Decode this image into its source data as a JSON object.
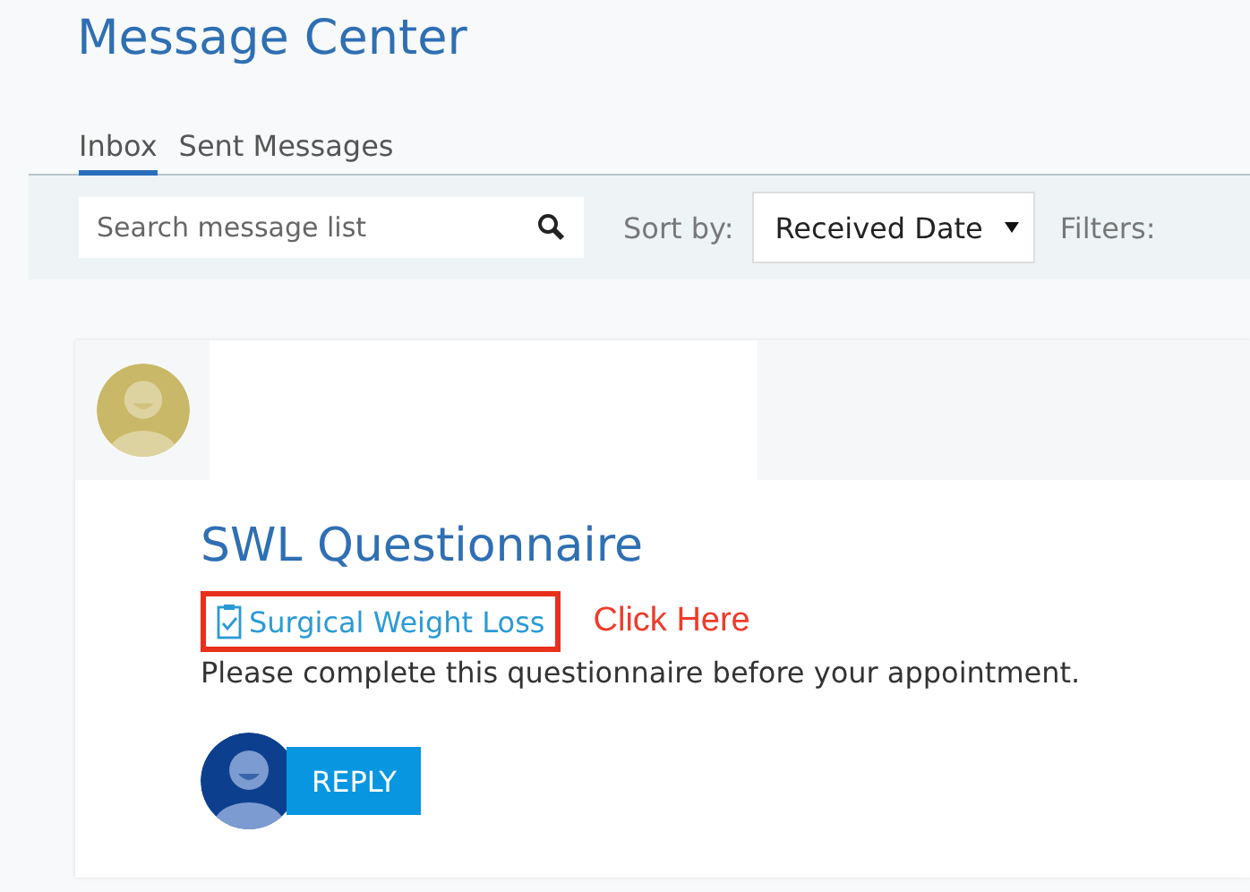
{
  "page": {
    "title": "Message Center"
  },
  "tabs": [
    {
      "label": "Inbox",
      "selected": true
    },
    {
      "label": "Sent Messages",
      "selected": false
    }
  ],
  "toolbar": {
    "search": {
      "placeholder": "Search message list"
    },
    "sort_label": "Sort by:",
    "sort_value": "Received Date",
    "filters_label": "Filters:"
  },
  "message": {
    "subject": "SWL Questionnaire",
    "link": "Surgical Weight Loss",
    "body": "Please complete this questionnaire before your appointment.",
    "reply_button": "REPLY"
  },
  "annotation": {
    "text": "Click Here"
  }
}
